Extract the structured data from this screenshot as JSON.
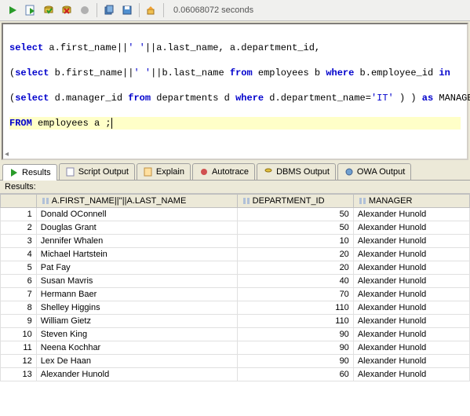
{
  "toolbar": {
    "time_label": "0.06068072 seconds"
  },
  "sql": {
    "line1_a": "select",
    "line1_b": " a.first_name||",
    "line1_c": "' '",
    "line1_d": "||a.last_name, a.department_id,",
    "line2_a": "(",
    "line2_b": "select",
    "line2_c": " b.first_name||",
    "line2_d": "' '",
    "line2_e": "||b.last_name ",
    "line2_f": "from",
    "line2_g": " employees b ",
    "line2_h": "where",
    "line2_i": " b.employee_id ",
    "line2_j": "in",
    "line3_a": "(",
    "line3_b": "select",
    "line3_c": " d.manager_id ",
    "line3_d": "from",
    "line3_e": " departments d ",
    "line3_f": "where",
    "line3_g": " d.department_name=",
    "line3_h": "'IT'",
    "line3_i": " ) ) ",
    "line3_j": "as",
    "line3_k": " MANAGER",
    "line4_a": "FROM",
    "line4_b": " employees a ;"
  },
  "tabs": {
    "results": "Results",
    "script": "Script Output",
    "explain": "Explain",
    "autotrace": "Autotrace",
    "dbms": "DBMS Output",
    "owa": "OWA Output"
  },
  "results_label": "Results:",
  "columns": {
    "c1": "A.FIRST_NAME||''||A.LAST_NAME",
    "c2": "DEPARTMENT_ID",
    "c3": "MANAGER"
  },
  "rows": [
    {
      "n": "1",
      "name": "Donald OConnell",
      "dept": "50",
      "mgr": "Alexander Hunold"
    },
    {
      "n": "2",
      "name": "Douglas Grant",
      "dept": "50",
      "mgr": "Alexander Hunold"
    },
    {
      "n": "3",
      "name": "Jennifer Whalen",
      "dept": "10",
      "mgr": "Alexander Hunold"
    },
    {
      "n": "4",
      "name": "Michael Hartstein",
      "dept": "20",
      "mgr": "Alexander Hunold"
    },
    {
      "n": "5",
      "name": "Pat Fay",
      "dept": "20",
      "mgr": "Alexander Hunold"
    },
    {
      "n": "6",
      "name": "Susan Mavris",
      "dept": "40",
      "mgr": "Alexander Hunold"
    },
    {
      "n": "7",
      "name": "Hermann Baer",
      "dept": "70",
      "mgr": "Alexander Hunold"
    },
    {
      "n": "8",
      "name": "Shelley Higgins",
      "dept": "110",
      "mgr": "Alexander Hunold"
    },
    {
      "n": "9",
      "name": "William Gietz",
      "dept": "110",
      "mgr": "Alexander Hunold"
    },
    {
      "n": "10",
      "name": "Steven King",
      "dept": "90",
      "mgr": "Alexander Hunold"
    },
    {
      "n": "11",
      "name": "Neena Kochhar",
      "dept": "90",
      "mgr": "Alexander Hunold"
    },
    {
      "n": "12",
      "name": "Lex De Haan",
      "dept": "90",
      "mgr": "Alexander Hunold"
    },
    {
      "n": "13",
      "name": "Alexander Hunold",
      "dept": "60",
      "mgr": "Alexander Hunold"
    }
  ]
}
